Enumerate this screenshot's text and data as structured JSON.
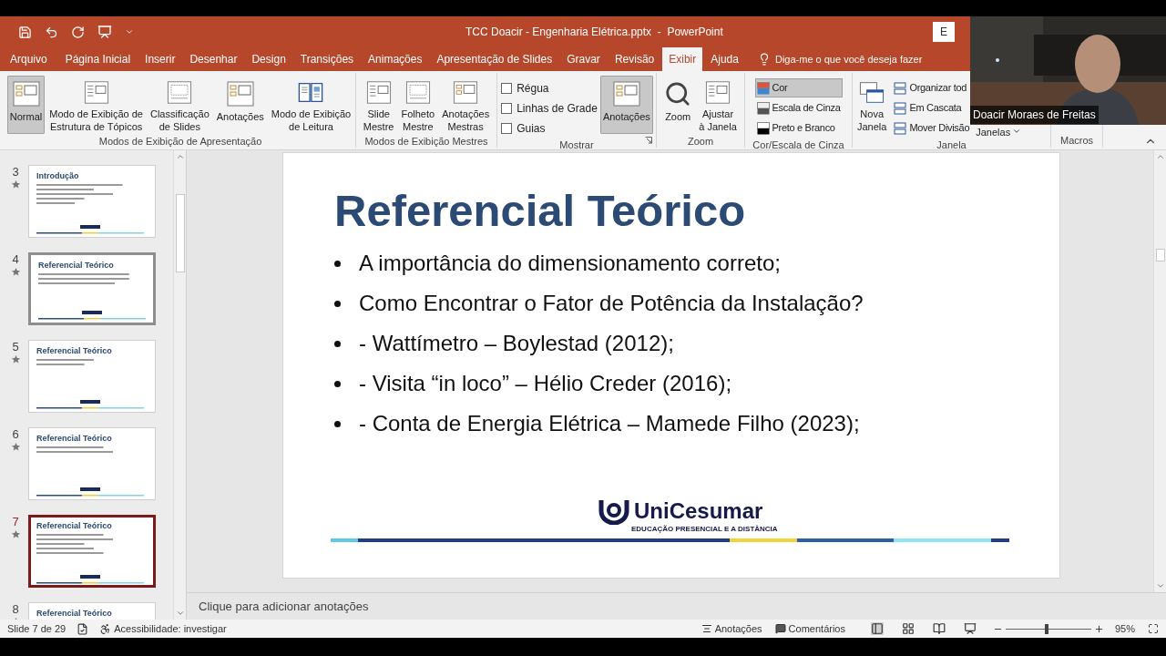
{
  "window": {
    "title": "TCC Doacir - Engenharia Elétrica.pptx  -  PowerPoint",
    "account_button": "E"
  },
  "tabs": [
    {
      "label": "Arquivo",
      "selected": false
    },
    {
      "label": "Página Inicial",
      "selected": false
    },
    {
      "label": "Inserir",
      "selected": false
    },
    {
      "label": "Desenhar",
      "selected": false
    },
    {
      "label": "Design",
      "selected": false
    },
    {
      "label": "Transições",
      "selected": false
    },
    {
      "label": "Animações",
      "selected": false
    },
    {
      "label": "Apresentação de Slides",
      "selected": false
    },
    {
      "label": "Gravar",
      "selected": false
    },
    {
      "label": "Revisão",
      "selected": false
    },
    {
      "label": "Exibir",
      "selected": true
    },
    {
      "label": "Ajuda",
      "selected": false
    }
  ],
  "tell_me": {
    "placeholder": "Diga-me o que você deseja fazer"
  },
  "ribbon": {
    "groups": [
      {
        "label": "Modos de Exibição de Apresentação",
        "items": [
          {
            "kind": "large",
            "label": "Normal",
            "selected": true
          },
          {
            "kind": "large",
            "label": "Modo de Exibição de\nEstrutura de Tópicos",
            "selected": false
          },
          {
            "kind": "large",
            "label": "Classificação\nde Slides",
            "selected": false
          },
          {
            "kind": "large",
            "label": "Anotações",
            "selected": false
          },
          {
            "kind": "large",
            "label": "Modo de Exibição\nde Leitura",
            "selected": false
          }
        ]
      },
      {
        "label": "Modos de Exibição Mestres",
        "items": [
          {
            "kind": "large",
            "label": "Slide\nMestre",
            "selected": false
          },
          {
            "kind": "large",
            "label": "Folheto\nMestre",
            "selected": false
          },
          {
            "kind": "large",
            "label": "Anotações\nMestras",
            "selected": false
          }
        ]
      },
      {
        "label": "Mostrar",
        "launcher": true,
        "items": [
          {
            "kind": "stack",
            "children": [
              {
                "kind": "check",
                "label": "Régua",
                "checked": false
              },
              {
                "kind": "check",
                "label": "Linhas de Grade",
                "checked": false
              },
              {
                "kind": "check",
                "label": "Guias",
                "checked": false
              }
            ]
          },
          {
            "kind": "large",
            "label": "Anotações",
            "selected": true
          }
        ]
      },
      {
        "label": "Zoom",
        "items": [
          {
            "kind": "large",
            "label": "Zoom",
            "selected": false
          },
          {
            "kind": "large",
            "label": "Ajustar\nà Janela",
            "selected": false
          }
        ]
      },
      {
        "label": "Cor/Escala de Cinza",
        "items": [
          {
            "kind": "stack",
            "children": [
              {
                "kind": "small",
                "label": "Cor",
                "selected": true
              },
              {
                "kind": "small",
                "label": "Escala de Cinza",
                "selected": false
              },
              {
                "kind": "small",
                "label": "Preto e Branco",
                "selected": false
              }
            ]
          }
        ]
      },
      {
        "label": "Janela",
        "items": [
          {
            "kind": "large",
            "label": "Nova\nJanela",
            "selected": false
          },
          {
            "kind": "stack",
            "children": [
              {
                "kind": "small",
                "label": "Organizar tod",
                "selected": false
              },
              {
                "kind": "small",
                "label": "Em Cascata",
                "selected": false
              },
              {
                "kind": "small",
                "label": "Mover Divisão",
                "selected": false
              }
            ]
          },
          {
            "kind": "dropdown",
            "label": "Janelas"
          }
        ]
      },
      {
        "label": "Macros"
      }
    ]
  },
  "slides_pane": {
    "items": [
      {
        "number": "3",
        "title": "Introdução",
        "selected": false,
        "hovered": false
      },
      {
        "number": "4",
        "title": "Referencial Teórico",
        "selected": false,
        "hovered": true
      },
      {
        "number": "5",
        "title": "Referencial Teórico",
        "selected": false,
        "hovered": false
      },
      {
        "number": "6",
        "title": "Referencial Teórico",
        "selected": false,
        "hovered": false
      },
      {
        "number": "7",
        "title": "Referencial Teórico",
        "selected": true,
        "hovered": false
      },
      {
        "number": "8",
        "title": "Referencial Teórico",
        "selected": false,
        "hovered": false
      }
    ]
  },
  "slide": {
    "title": "Referencial Teórico",
    "bullets": [
      "A importância do dimensionamento correto;",
      "Como Encontrar o Fator de Potência da Instalação?",
      "- Wattímetro – Boylestad (2012);",
      "- Visita “in loco” – Hélio Creder (2016);",
      "- Conta de Energia Elétrica – Mamede Filho (2023);"
    ],
    "logo": {
      "name": "UniCesumar",
      "tagline": "EDUCAÇÃO PRESENCIAL E A DISTÂNCIA"
    }
  },
  "notes": {
    "placeholder": "Clique para adicionar anotações"
  },
  "status_bar": {
    "slide": "Slide 7 de 29",
    "accessibility": "Acessibilidade: investigar",
    "notes": "Anotações",
    "comments": "Comentários",
    "zoom": {
      "level": 0.48,
      "reading": "95%"
    }
  },
  "webcam": {
    "name": "Doacir Moraes de Freitas"
  }
}
